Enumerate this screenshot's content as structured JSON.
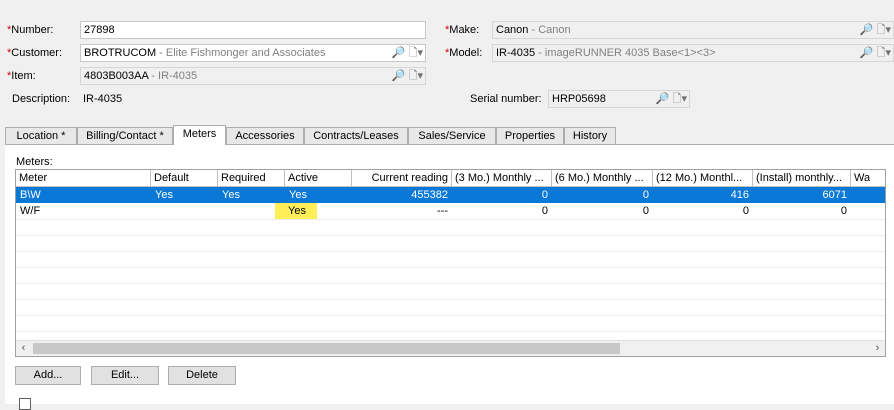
{
  "form": {
    "number": {
      "star": "*",
      "label": "Number:",
      "value": "27898"
    },
    "customer": {
      "star": "*",
      "label": "Customer:",
      "code": "BROTRUCOM",
      "sep": " - ",
      "name": "Elite Fishmonger and Associates"
    },
    "item": {
      "star": "*",
      "label": "Item:",
      "code": "4803B003AA",
      "sep": " - ",
      "name": "IR-4035"
    },
    "description": {
      "label": "Description:",
      "value": "IR-4035"
    },
    "make": {
      "star": "*",
      "label": "Make:",
      "code": "Canon",
      "sep": " - ",
      "name": "Canon"
    },
    "model": {
      "star": "*",
      "label": "Model:",
      "code": "IR-4035",
      "sep": " - ",
      "name": "imageRUNNER 4035 Base<1><3>"
    },
    "serial": {
      "label": "Serial number:",
      "value": "HRP05698"
    }
  },
  "icons": {
    "lookup": "🔎",
    "dropdown": "▾",
    "doc": "🗋"
  },
  "tabs": [
    "Location *",
    "Billing/Contact *",
    "Meters",
    "Accessories",
    "Contracts/Leases",
    "Sales/Service",
    "Properties",
    "History"
  ],
  "active_tab": "Meters",
  "meters": {
    "section_label": "Meters:",
    "columns": [
      "Meter",
      "Default",
      "Required",
      "Active",
      "Current reading",
      "(3 Mo.) Monthly ...",
      "(6 Mo.) Monthly ...",
      "(12 Mo.) Monthl...",
      "(Install) monthly...",
      "Wa"
    ],
    "rows": [
      {
        "meter": "B\\W",
        "default": "Yes",
        "required": "Yes",
        "active": "Yes",
        "current": "455382",
        "m3": "0",
        "m6": "0",
        "m12": "416",
        "install": "6071",
        "selected": true
      },
      {
        "meter": "W/F",
        "default": "",
        "required": "",
        "active": "Yes",
        "current": "---",
        "m3": "0",
        "m6": "0",
        "m12": "0",
        "install": "0",
        "selected": false
      }
    ],
    "scroll_left": "‹",
    "scroll_right": "›"
  },
  "buttons": {
    "add": "Add...",
    "edit": "Edit...",
    "delete": "Delete"
  }
}
